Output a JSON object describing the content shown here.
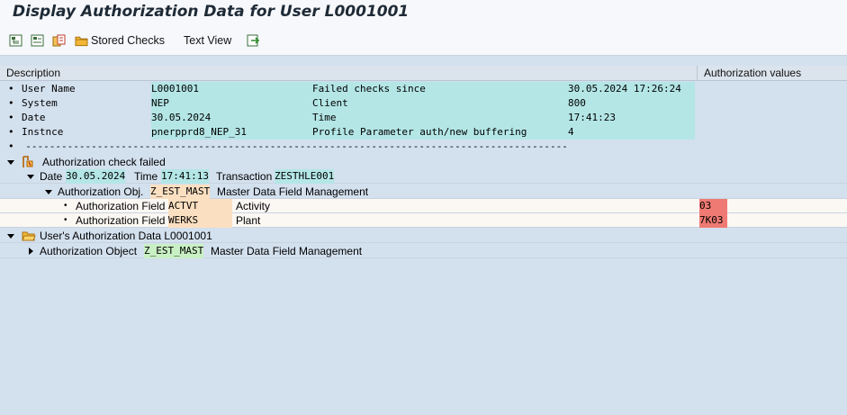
{
  "window": {
    "title": "Display Authorization Data for User L0001001"
  },
  "toolbar": {
    "stored_checks_label": "Stored Checks",
    "text_view_label": "Text View"
  },
  "columns": {
    "description": "Description",
    "auth_values": "Authorization values"
  },
  "info": [
    {
      "label": "User Name",
      "value": "L0001001",
      "label2": "Failed checks since",
      "value2": "30.05.2024 17:26:24"
    },
    {
      "label": "System",
      "value": "NEP",
      "label2": "Client",
      "value2": "800"
    },
    {
      "label": "Date",
      "value": "30.05.2024",
      "label2": "Time",
      "value2": "17:41:23"
    },
    {
      "label": "Instnce",
      "value": "pnerpprd8_NEP_31",
      "label2": "Profile Parameter auth/new buffering",
      "value2": "4"
    }
  ],
  "dashes": "-------------------------------------------------------------------------------------------",
  "bullet": "•",
  "tree": {
    "failed_label": "Authorization check failed",
    "date_label": "Date",
    "date_value": "30.05.2024",
    "time_label": "Time",
    "time_value": "17:41:13",
    "transaction_label": "Transaction",
    "transaction_value": "ZESTHLE001",
    "obj_label": "Authorization Obj.",
    "obj_value": "Z_EST_MAST",
    "obj_desc": "Master Data Field Management",
    "field_label": "Authorization Field",
    "fields": [
      {
        "name": "ACTVT",
        "desc": "Activity",
        "value": "03"
      },
      {
        "name": "WERKS",
        "desc": "Plant",
        "value": "7K03"
      }
    ],
    "user_data_label": "User's Authorization Data L0001001",
    "object_label": "Authorization Object",
    "object_value": "Z_EST_MAST",
    "object_desc": "Master Data Field Management"
  },
  "colors": {
    "background": "#d3e0ee",
    "teal": "#b4e6e6",
    "tan": "#fbdfc1",
    "green": "#c9f0c4",
    "red": "#ef7a73"
  },
  "icons": [
    "expand-all-icon",
    "collapse-all-icon",
    "copy-icon",
    "folder-icon",
    "export-icon",
    "failed-check-icon",
    "open-folder-icon"
  ]
}
